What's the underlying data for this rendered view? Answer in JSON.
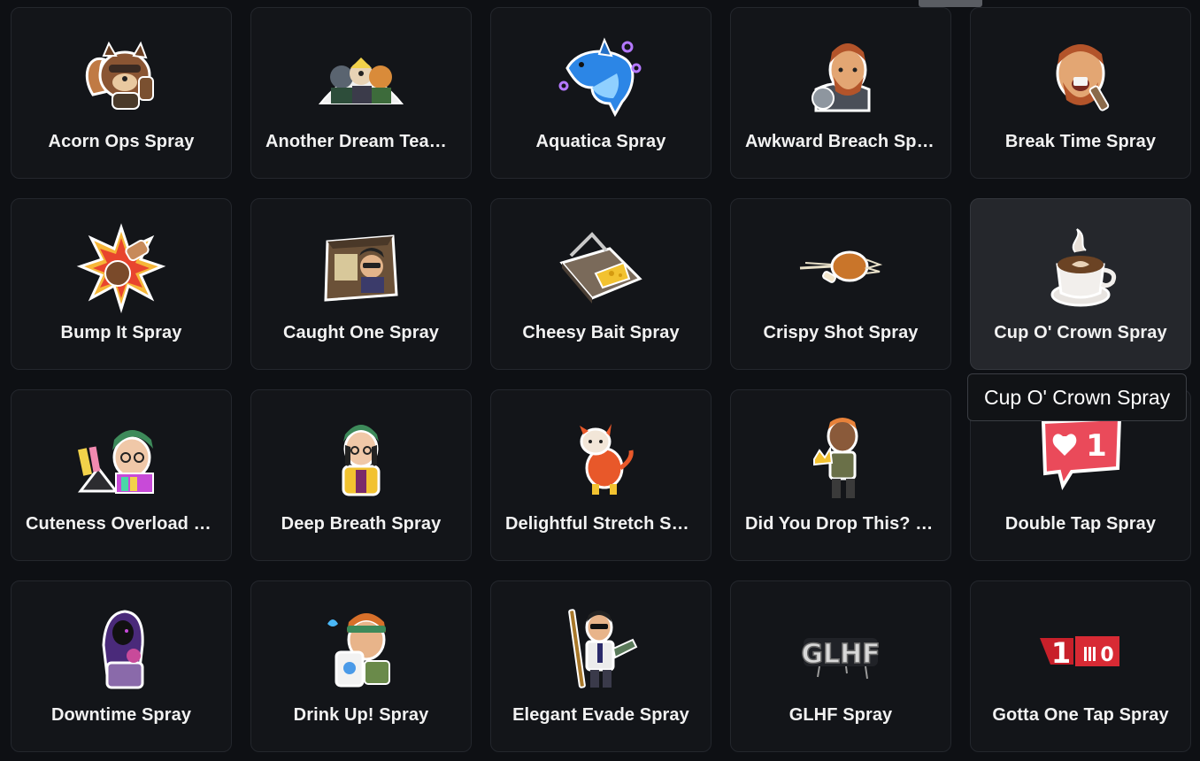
{
  "sprays": [
    {
      "label": "Acorn Ops Spray",
      "icon": "squirrel-icon"
    },
    {
      "label": "Another Dream Team Spray",
      "icon": "trio-agents-icon"
    },
    {
      "label": "Aquatica Spray",
      "icon": "dolphin-icon"
    },
    {
      "label": "Awkward Breach Spray",
      "icon": "breach-agent-icon"
    },
    {
      "label": "Break Time Spray",
      "icon": "eating-agent-icon"
    },
    {
      "label": "Bump It Spray",
      "icon": "fist-bump-icon"
    },
    {
      "label": "Caught One Spray",
      "icon": "box-agent-icon"
    },
    {
      "label": "Cheesy Bait Spray",
      "icon": "mousetrap-icon"
    },
    {
      "label": "Crispy Shot Spray",
      "icon": "chicken-leg-icon"
    },
    {
      "label": "Cup O' Crown Spray",
      "icon": "coffee-cup-icon"
    },
    {
      "label": "Cuteness Overload Spray",
      "icon": "gamer-agent-icon"
    },
    {
      "label": "Deep Breath Spray",
      "icon": "beanie-agent-icon"
    },
    {
      "label": "Delightful Stretch Spray",
      "icon": "stretching-dog-icon"
    },
    {
      "label": "Did You Drop This? Spray",
      "icon": "crown-agent-icon"
    },
    {
      "label": "Double Tap Spray",
      "icon": "heart-notification-icon"
    },
    {
      "label": "Downtime Spray",
      "icon": "hooded-agent-icon"
    },
    {
      "label": "Drink Up! Spray",
      "icon": "drinking-agent-icon"
    },
    {
      "label": "Elegant Evade Spray",
      "icon": "suited-agent-icon"
    },
    {
      "label": "GLHF Spray",
      "icon": "glhf-graffiti-icon"
    },
    {
      "label": "Gotta One Tap Spray",
      "icon": "scoreboard-icon"
    }
  ],
  "hovered_index": 9,
  "tooltip": "Cup O' Crown Spray",
  "heart_badge_count": "1",
  "glhf_text": "GLHF",
  "scoreboard_left": "1",
  "scoreboard_right": "0"
}
